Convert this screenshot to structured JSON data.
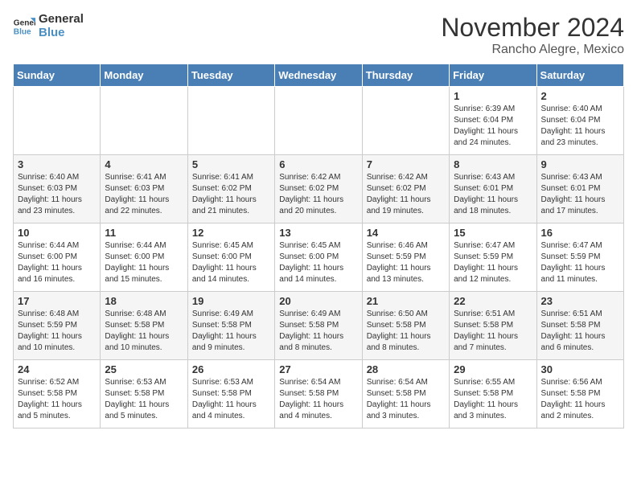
{
  "logo": {
    "line1": "General",
    "line2": "Blue"
  },
  "header": {
    "month": "November 2024",
    "location": "Rancho Alegre, Mexico"
  },
  "weekdays": [
    "Sunday",
    "Monday",
    "Tuesday",
    "Wednesday",
    "Thursday",
    "Friday",
    "Saturday"
  ],
  "weeks": [
    [
      {
        "day": "",
        "info": ""
      },
      {
        "day": "",
        "info": ""
      },
      {
        "day": "",
        "info": ""
      },
      {
        "day": "",
        "info": ""
      },
      {
        "day": "",
        "info": ""
      },
      {
        "day": "1",
        "info": "Sunrise: 6:39 AM\nSunset: 6:04 PM\nDaylight: 11 hours and 24 minutes."
      },
      {
        "day": "2",
        "info": "Sunrise: 6:40 AM\nSunset: 6:04 PM\nDaylight: 11 hours and 23 minutes."
      }
    ],
    [
      {
        "day": "3",
        "info": "Sunrise: 6:40 AM\nSunset: 6:03 PM\nDaylight: 11 hours and 23 minutes."
      },
      {
        "day": "4",
        "info": "Sunrise: 6:41 AM\nSunset: 6:03 PM\nDaylight: 11 hours and 22 minutes."
      },
      {
        "day": "5",
        "info": "Sunrise: 6:41 AM\nSunset: 6:02 PM\nDaylight: 11 hours and 21 minutes."
      },
      {
        "day": "6",
        "info": "Sunrise: 6:42 AM\nSunset: 6:02 PM\nDaylight: 11 hours and 20 minutes."
      },
      {
        "day": "7",
        "info": "Sunrise: 6:42 AM\nSunset: 6:02 PM\nDaylight: 11 hours and 19 minutes."
      },
      {
        "day": "8",
        "info": "Sunrise: 6:43 AM\nSunset: 6:01 PM\nDaylight: 11 hours and 18 minutes."
      },
      {
        "day": "9",
        "info": "Sunrise: 6:43 AM\nSunset: 6:01 PM\nDaylight: 11 hours and 17 minutes."
      }
    ],
    [
      {
        "day": "10",
        "info": "Sunrise: 6:44 AM\nSunset: 6:00 PM\nDaylight: 11 hours and 16 minutes."
      },
      {
        "day": "11",
        "info": "Sunrise: 6:44 AM\nSunset: 6:00 PM\nDaylight: 11 hours and 15 minutes."
      },
      {
        "day": "12",
        "info": "Sunrise: 6:45 AM\nSunset: 6:00 PM\nDaylight: 11 hours and 14 minutes."
      },
      {
        "day": "13",
        "info": "Sunrise: 6:45 AM\nSunset: 6:00 PM\nDaylight: 11 hours and 14 minutes."
      },
      {
        "day": "14",
        "info": "Sunrise: 6:46 AM\nSunset: 5:59 PM\nDaylight: 11 hours and 13 minutes."
      },
      {
        "day": "15",
        "info": "Sunrise: 6:47 AM\nSunset: 5:59 PM\nDaylight: 11 hours and 12 minutes."
      },
      {
        "day": "16",
        "info": "Sunrise: 6:47 AM\nSunset: 5:59 PM\nDaylight: 11 hours and 11 minutes."
      }
    ],
    [
      {
        "day": "17",
        "info": "Sunrise: 6:48 AM\nSunset: 5:59 PM\nDaylight: 11 hours and 10 minutes."
      },
      {
        "day": "18",
        "info": "Sunrise: 6:48 AM\nSunset: 5:58 PM\nDaylight: 11 hours and 10 minutes."
      },
      {
        "day": "19",
        "info": "Sunrise: 6:49 AM\nSunset: 5:58 PM\nDaylight: 11 hours and 9 minutes."
      },
      {
        "day": "20",
        "info": "Sunrise: 6:49 AM\nSunset: 5:58 PM\nDaylight: 11 hours and 8 minutes."
      },
      {
        "day": "21",
        "info": "Sunrise: 6:50 AM\nSunset: 5:58 PM\nDaylight: 11 hours and 8 minutes."
      },
      {
        "day": "22",
        "info": "Sunrise: 6:51 AM\nSunset: 5:58 PM\nDaylight: 11 hours and 7 minutes."
      },
      {
        "day": "23",
        "info": "Sunrise: 6:51 AM\nSunset: 5:58 PM\nDaylight: 11 hours and 6 minutes."
      }
    ],
    [
      {
        "day": "24",
        "info": "Sunrise: 6:52 AM\nSunset: 5:58 PM\nDaylight: 11 hours and 5 minutes."
      },
      {
        "day": "25",
        "info": "Sunrise: 6:53 AM\nSunset: 5:58 PM\nDaylight: 11 hours and 5 minutes."
      },
      {
        "day": "26",
        "info": "Sunrise: 6:53 AM\nSunset: 5:58 PM\nDaylight: 11 hours and 4 minutes."
      },
      {
        "day": "27",
        "info": "Sunrise: 6:54 AM\nSunset: 5:58 PM\nDaylight: 11 hours and 4 minutes."
      },
      {
        "day": "28",
        "info": "Sunrise: 6:54 AM\nSunset: 5:58 PM\nDaylight: 11 hours and 3 minutes."
      },
      {
        "day": "29",
        "info": "Sunrise: 6:55 AM\nSunset: 5:58 PM\nDaylight: 11 hours and 3 minutes."
      },
      {
        "day": "30",
        "info": "Sunrise: 6:56 AM\nSunset: 5:58 PM\nDaylight: 11 hours and 2 minutes."
      }
    ]
  ]
}
